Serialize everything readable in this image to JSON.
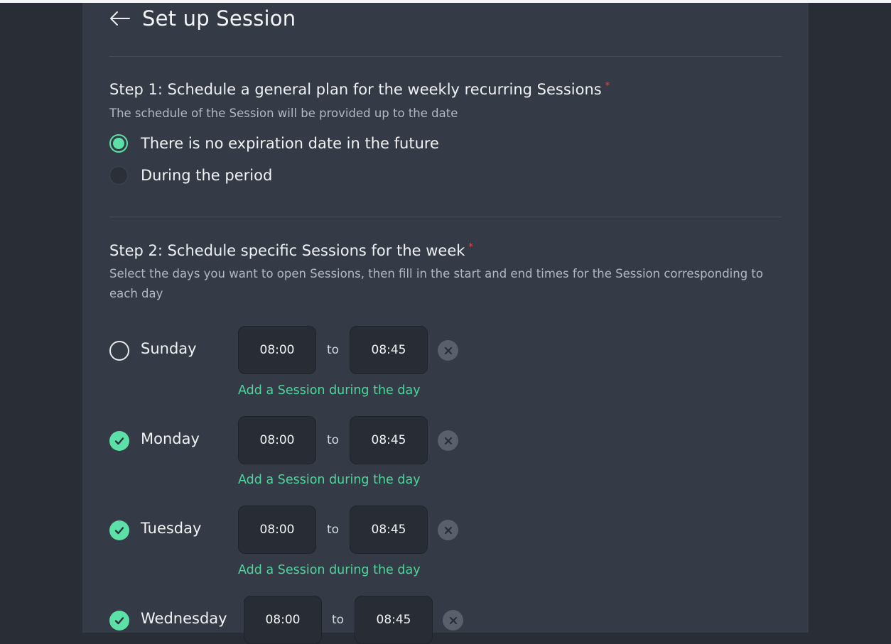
{
  "header": {
    "title": "Set up Session",
    "back_icon": "arrow-left-icon"
  },
  "step1": {
    "title": "Step 1: Schedule a general plan for the weekly recurring Sessions",
    "required_mark": "*",
    "description": "The schedule of the Session will be provided up to the date",
    "options": [
      {
        "label": "There is no expiration date in the future",
        "selected": true
      },
      {
        "label": "During the period",
        "selected": false
      }
    ]
  },
  "step2": {
    "title": "Step 2: Schedule specific Sessions for the week",
    "required_mark": "*",
    "description": "Select the days you want to open Sessions, then fill in the start and end times for the Session corresponding to each day",
    "to_label": "to",
    "add_label": "Add a Session during the day",
    "days": [
      {
        "name": "Sunday",
        "checked": false,
        "start": "08:00",
        "end": "08:45"
      },
      {
        "name": "Monday",
        "checked": true,
        "start": "08:00",
        "end": "08:45"
      },
      {
        "name": "Tuesday",
        "checked": true,
        "start": "08:00",
        "end": "08:45"
      },
      {
        "name": "Wednesday",
        "checked": true,
        "start": "08:00",
        "end": "08:45"
      }
    ]
  },
  "colors": {
    "accent": "#5ce0a8",
    "link": "#4fd59d",
    "panel": "#353b46",
    "background": "#282d36",
    "required": "#e04848"
  }
}
